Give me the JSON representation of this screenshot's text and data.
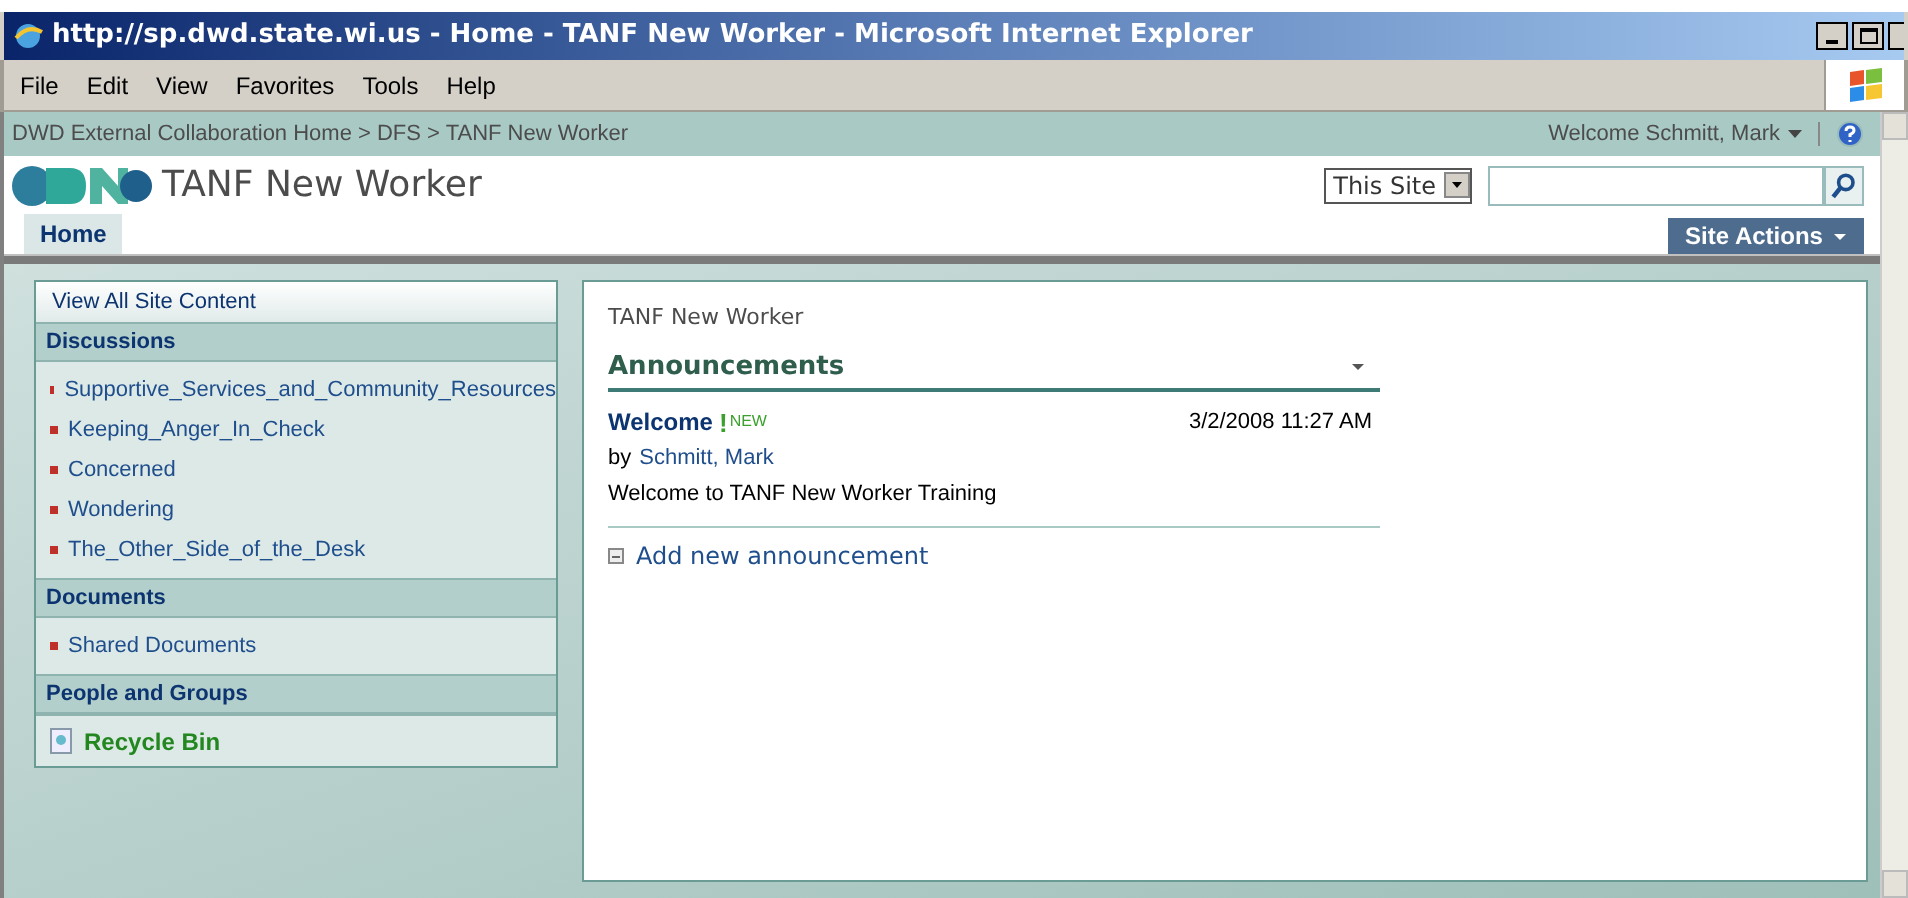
{
  "window": {
    "title": "http://sp.dwd.state.wi.us - Home - TANF New Worker - Microsoft Internet Explorer"
  },
  "menu": [
    "File",
    "Edit",
    "View",
    "Favorites",
    "Tools",
    "Help"
  ],
  "breadcrumb": "DWD External Collaboration Home > DFS > TANF New Worker",
  "welcome": "Welcome Schmitt, Mark",
  "site_title": "TANF New Worker",
  "scope": "This Site",
  "tabs": [
    {
      "label": "Home",
      "selected": true
    }
  ],
  "site_actions": "Site Actions",
  "sidebar": {
    "view_all": "View All Site Content",
    "sections": [
      {
        "heading": "Discussions",
        "items": [
          "Supportive_Services_and_Community_Resources",
          "Keeping_Anger_In_Check",
          "Concerned",
          "Wondering",
          "The_Other_Side_of_the_Desk"
        ]
      },
      {
        "heading": "Documents",
        "items": [
          "Shared Documents"
        ]
      },
      {
        "heading": "People and Groups"
      }
    ],
    "recycle_bin": "Recycle Bin"
  },
  "main": {
    "page_title": "TANF New Worker",
    "web_part_title": "Announcements",
    "announcements": [
      {
        "title": "Welcome",
        "new_mark": "!",
        "new_badge": "NEW",
        "date": "3/2/2008 11:27 AM",
        "by": "by",
        "author": "Schmitt, Mark",
        "body": "Welcome to TANF New Worker Training"
      }
    ],
    "add_link": "Add new announcement"
  }
}
